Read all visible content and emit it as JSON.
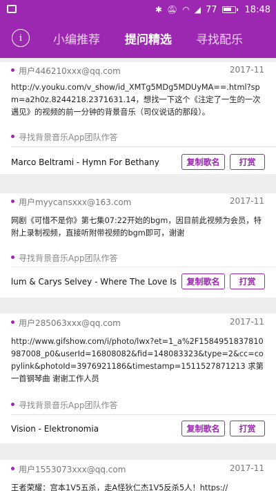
{
  "status_bar": {
    "battery_level": "77",
    "time": "18:48"
  },
  "nav": {
    "info_glyph": "i",
    "tabs": [
      {
        "label": "小编推荐",
        "active": false
      },
      {
        "label": "提问精选",
        "active": true
      },
      {
        "label": "寻找配乐",
        "active": false
      }
    ]
  },
  "colors": {
    "accent": "#9c27b0",
    "background": "#eeeeee"
  },
  "posts": [
    {
      "user": "用户446210xxx@qq.com",
      "date": "2017-11",
      "question": "http://v.youku.com/v_show/id_XMTg5MDg5MDUyMA==.html?spm=a2h0z.8244218.2371631.14，想找一下这个《注定了一生的一次遇见》的视频的前一分钟的背景音乐（司仪说话的那段）。",
      "answered_by": "寻找背景音乐App团队作答",
      "song": "Marco Beltrami - Hymn For Bethany",
      "copy_label": "复制歌名",
      "tip_label": "打赏"
    },
    {
      "user": "用户myycansxxx@163.com",
      "date": "2017-11",
      "question": "网剧《可惜不是你》第七集07:22开始的bgm，因目前此视频为会员，特附上录制视频，直接听附带视频的bgm即可，谢谢",
      "answered_by": "寻找背景音乐App团队作答",
      "song": "Cullum & Carys Selvey - Where The Love Is",
      "copy_label": "复制歌名",
      "tip_label": "打赏"
    },
    {
      "user": "用户285063xxx@qq.com",
      "date": "2017-11",
      "question": "http://www.gifshow.com/i/photo/lwx?et=1_a%2F1584951837810987008_p0&userId=16808082&fid=148083323&type=2&cc=copylink&photoId=3976921186&timestamp=1511527871213 求第一首钢琴曲 谢谢工作人员",
      "answered_by": "寻找背景音乐App团队作答",
      "song": "Vision - Elektronomia",
      "copy_label": "复制歌名",
      "tip_label": "打赏"
    },
    {
      "user": "用户1553073xxx@qq.com",
      "date": "2017-11",
      "question": "王者荣耀：宫本1V5五杀，走A怪狄仁杰1V5反杀5人！https://",
      "answered_by": "",
      "song": "",
      "copy_label": "",
      "tip_label": ""
    }
  ]
}
